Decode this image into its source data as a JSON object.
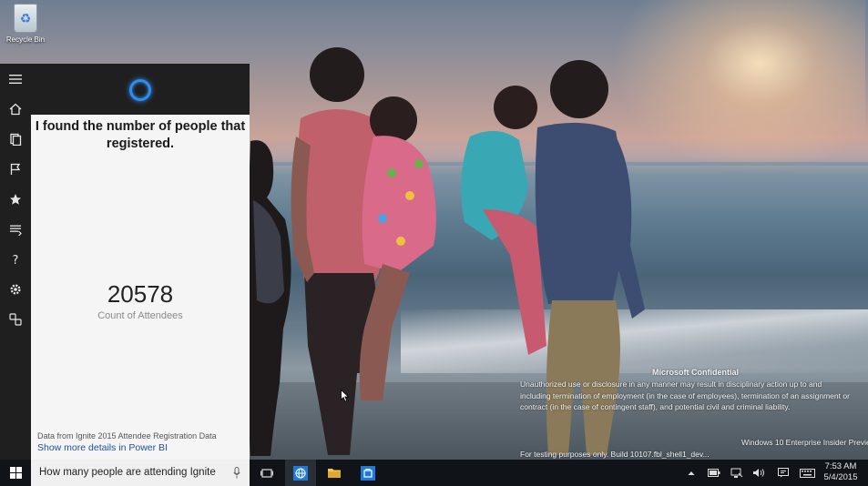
{
  "desktop": {
    "recycle_bin_label": "Recycle Bin"
  },
  "watermark": {
    "title": "Microsoft Confidential",
    "body_lines": [
      "Unauthorized use or disclosure in any manner may result in disciplinary action up to and",
      "including termination of employment (in the case of employees), termination of an assignment or",
      "contract (in the case of contingent staff), and potential civil and criminal liability."
    ],
    "edition": "Windows 10 Enterprise Insider Preview",
    "build": "For testing purposes only. Build 10107.fbl_shell1_dev..."
  },
  "cortana": {
    "message": "I found the number of people that registered.",
    "count_value": "20578",
    "count_label": "Count of Attendees",
    "source": "Data from Ignite 2015 Attendee Registration Data",
    "link": "Show more details in Power BI",
    "accent_color": "#2e8ef0",
    "rail_icons": [
      "hamburger-icon",
      "home-icon",
      "notebook-icon",
      "flag-icon",
      "star-icon",
      "news-icon",
      "help-icon",
      "settings-icon",
      "feedback-icon"
    ]
  },
  "taskbar": {
    "search_query": "How many people are attending Ignite",
    "time": "7:53 AM",
    "date": "5/4/2015",
    "pinned": [
      "task-view",
      "edge-browser",
      "file-explorer",
      "store"
    ]
  }
}
